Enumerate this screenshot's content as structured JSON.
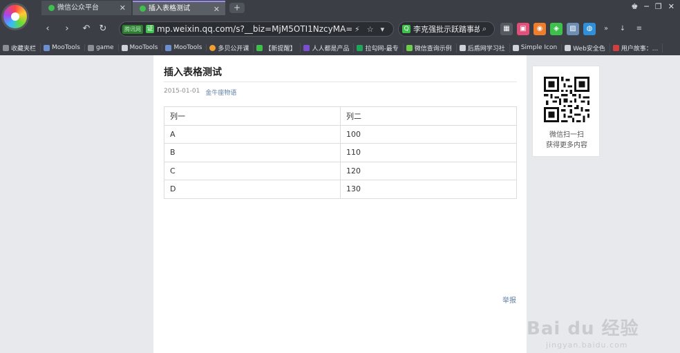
{
  "browser": {
    "tabs": [
      {
        "label": "微信公众平台"
      },
      {
        "label": "插入表格测试"
      }
    ],
    "address": {
      "trust_badge": "腾讯网",
      "cert_badge": "证",
      "url": "mp.weixin.qq.com/s?__biz=MjM5OTI1NzcyMA==&"
    },
    "search": {
      "query": "李克强批示跃踏事故",
      "engine_badge": "Q"
    },
    "bookmarks": [
      {
        "label": "收藏夹栏"
      },
      {
        "label": "MooTools"
      },
      {
        "label": "game"
      },
      {
        "label": "MooTools"
      },
      {
        "label": "MooTools"
      },
      {
        "label": "多贝公开课"
      },
      {
        "label": "【新提醒】"
      },
      {
        "label": "人人都是产品"
      },
      {
        "label": "拉勾网-最专"
      },
      {
        "label": "微信查询示例"
      },
      {
        "label": "后盾网学习社"
      },
      {
        "label": "Simple Icon"
      },
      {
        "label": "Web安全色"
      },
      {
        "label": "用户故事：..."
      }
    ]
  },
  "article": {
    "title": "插入表格测试",
    "date": "2015-01-01",
    "account": "金牛座物语",
    "table": {
      "rows": [
        [
          "列一",
          "列二"
        ],
        [
          "A",
          "100"
        ],
        [
          "B",
          "110"
        ],
        [
          "C",
          "120"
        ],
        [
          "D",
          "130"
        ]
      ]
    },
    "report_link": "举报"
  },
  "sidebar": {
    "qr_caption_line1": "微信扫一扫",
    "qr_caption_line2": "获得更多内容"
  },
  "watermark": {
    "brand": "Bai du 经验",
    "sub": "jingyan.baidu.com"
  },
  "colors": {
    "chrome_bg": "#3b3f45",
    "page_bg": "#ffffff",
    "link": "#607fa6",
    "wechat_green": "#3fbf4b"
  }
}
